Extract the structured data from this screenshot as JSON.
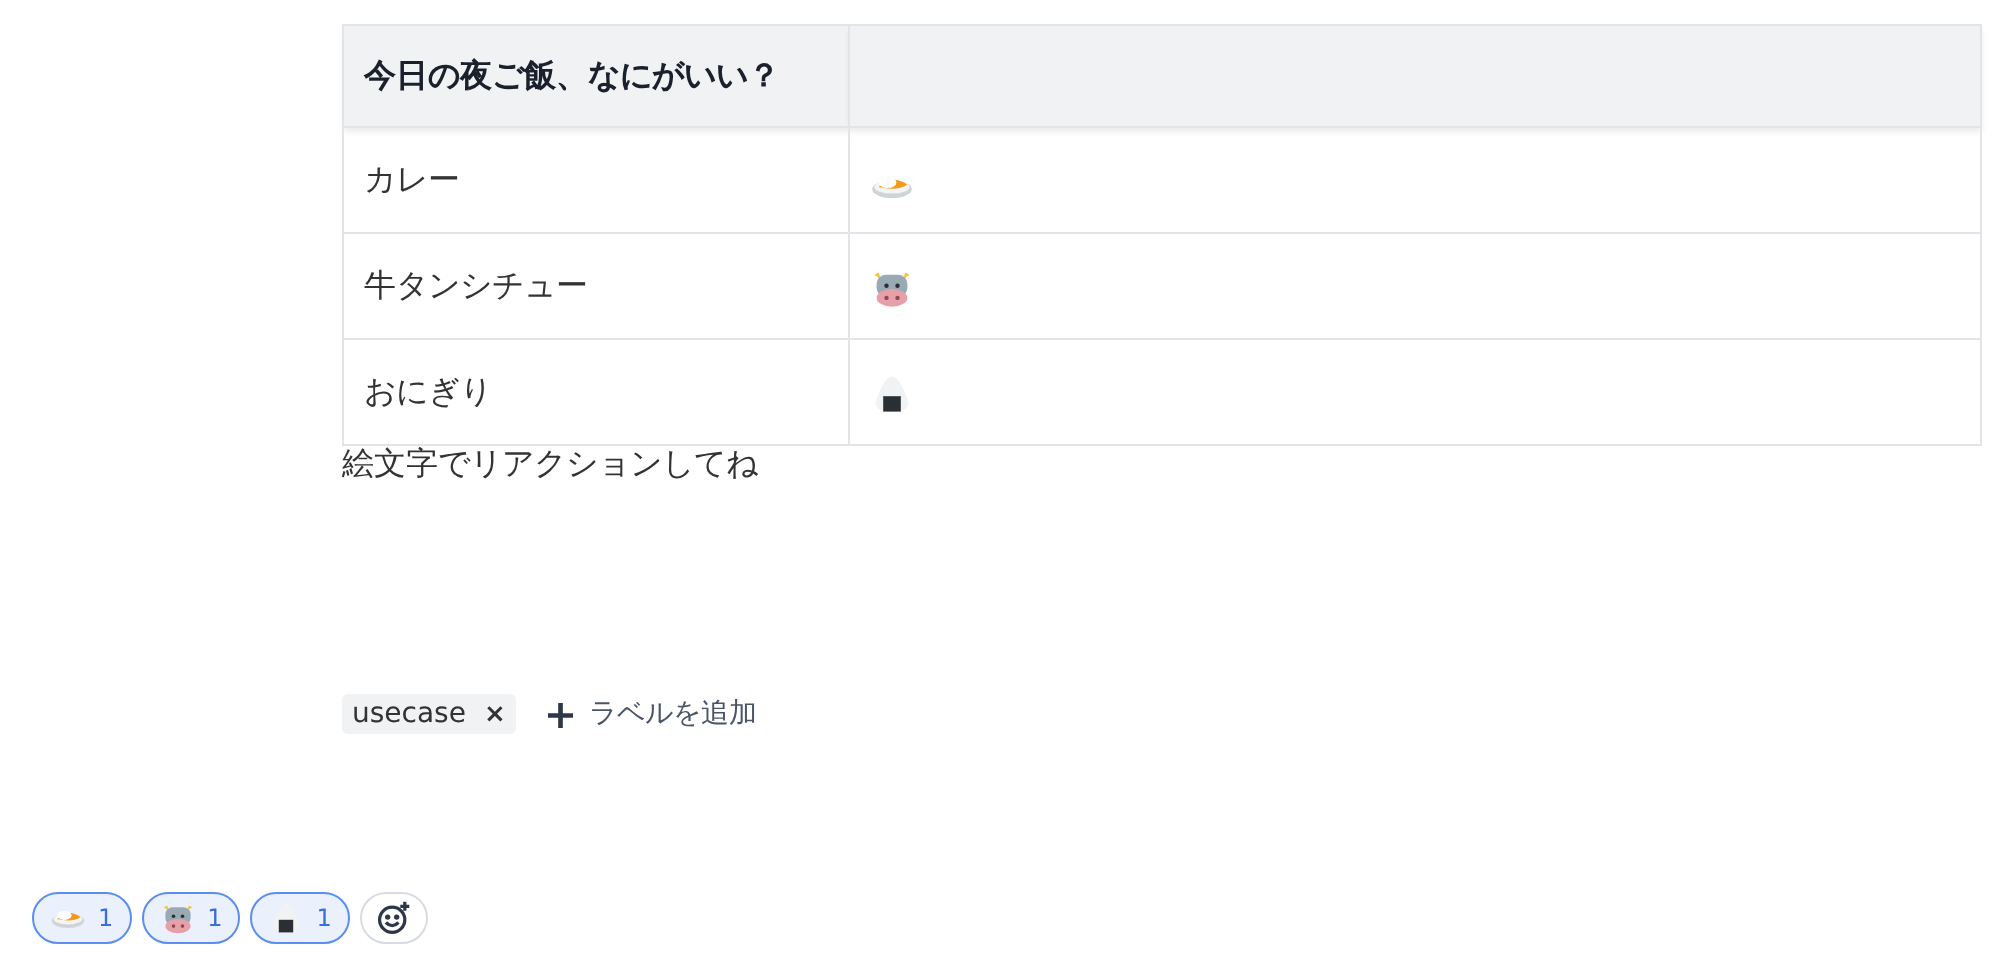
{
  "table": {
    "columns": [
      "今日の夜ご飯、なにがいい？"
    ],
    "rows": [
      {
        "label": "カレー",
        "kind": "curry"
      },
      {
        "label": "牛タンシチュー",
        "kind": "cow"
      },
      {
        "label": "おにぎり",
        "kind": "onigiri"
      }
    ]
  },
  "body_text": "絵文字でリアクションしてね",
  "labels": [
    {
      "text": "usecase",
      "remove": "×"
    }
  ],
  "add_label": {
    "icon": "+",
    "text": "ラベルを追加"
  },
  "reactions": [
    {
      "kind": "curry",
      "count": "1",
      "selected": true
    },
    {
      "kind": "cow",
      "count": "1",
      "selected": true
    },
    {
      "kind": "onigiri",
      "count": "1",
      "selected": true
    }
  ]
}
